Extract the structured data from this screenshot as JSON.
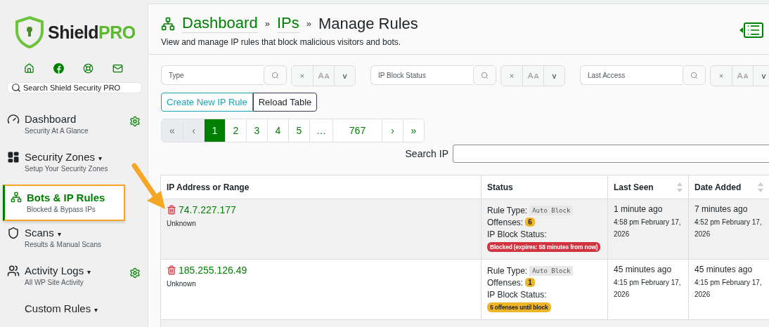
{
  "sidebar": {
    "logo": {
      "word": "Shield",
      "accent": "PRO"
    },
    "links": [
      {
        "kind": "home"
      },
      {
        "kind": "facebook"
      },
      {
        "kind": "support"
      },
      {
        "kind": "mail"
      }
    ],
    "search": {
      "placeholder": "Search Shield Security PRO"
    },
    "items": [
      {
        "kind": "dashboard",
        "title": "Dashboard",
        "subtitle": "Security At A Glance",
        "settings": true,
        "selected": false
      },
      {
        "kind": "zones",
        "title": "Security Zones",
        "caret": "▾",
        "subtitle": "Setup Your Security Zones",
        "settings": false,
        "selected": false
      },
      {
        "kind": "network",
        "title": "Bots & IP Rules",
        "subtitle": "Blocked & Bypass IPs",
        "settings": false,
        "selected": true
      },
      {
        "kind": "shield",
        "title": "Scans",
        "caret": "▾",
        "subtitle": "Results & Manual Scans",
        "settings": false,
        "selected": false
      },
      {
        "kind": "logs",
        "title": "Activity Logs",
        "caret": "▾",
        "subtitle": "All WP Site Activity",
        "settings": true,
        "selected": false
      },
      {
        "kind": "none",
        "title": "Custom Rules",
        "caret": "▾",
        "settings": false,
        "selected": false
      }
    ]
  },
  "header": {
    "breadcrumb": [
      {
        "label": "Dashboard",
        "kind": "link"
      },
      {
        "label": "»",
        "kind": "separator"
      },
      {
        "label": "IPs",
        "kind": "link"
      },
      {
        "label": "»",
        "kind": "separator"
      },
      {
        "label": "Manage Rules",
        "kind": "current"
      }
    ],
    "description": "View and manage IP rules that block malicious visitors and bots."
  },
  "filters": [
    {
      "placeholder": "Type",
      "clear": "×",
      "more": "v"
    },
    {
      "placeholder": "IP Block Status",
      "clear": "×",
      "more": "v"
    },
    {
      "placeholder": "Last Access",
      "clear": "×",
      "more": "v"
    }
  ],
  "actions": [
    {
      "label": "Create New IP Rule",
      "kind": "primary"
    },
    {
      "label": "Reload Table",
      "kind": "secondary"
    }
  ],
  "pagination": [
    {
      "label": "«",
      "selected": false,
      "disabled": true
    },
    {
      "label": "‹",
      "selected": false,
      "disabled": true
    },
    {
      "label": "1",
      "selected": true,
      "disabled": false
    },
    {
      "label": "2",
      "selected": false,
      "disabled": false
    },
    {
      "label": "3",
      "selected": false,
      "disabled": false
    },
    {
      "label": "4",
      "selected": false,
      "disabled": false
    },
    {
      "label": "5",
      "selected": false,
      "disabled": false
    },
    {
      "label": "…",
      "selected": false,
      "disabled": false
    },
    {
      "label": "767",
      "selected": false,
      "disabled": false
    },
    {
      "label": "›",
      "selected": false,
      "disabled": false
    },
    {
      "label": "»",
      "selected": false,
      "disabled": false
    }
  ],
  "search_ip": {
    "label": "Search IP"
  },
  "table": {
    "columns": [
      {
        "label": "IP Address or Range",
        "sortable": false
      },
      {
        "label": "Status",
        "sortable": false
      },
      {
        "label": "Last Seen",
        "sortable": true
      },
      {
        "label": "Date Added",
        "sortable": true
      }
    ],
    "rows": [
      {
        "ip": "74.7.227.177",
        "location": "Unknown",
        "rule_type_label": "Rule Type:",
        "rule_type": "Auto Block",
        "offenses_label": "Offenses:",
        "offenses": "6",
        "block_status_label": "IP Block Status:",
        "badge": {
          "text": "Blocked (expires: 58 minutes from now)",
          "kind": "blocked"
        },
        "last_seen": "1 minute ago",
        "last_seen_date": "4:58 pm February 17, 2026",
        "date_added": "7 minutes ago",
        "date_added_date": "4:52 pm February 17, 2026"
      },
      {
        "ip": "185.255.126.49",
        "location": "Unknown",
        "rule_type_label": "Rule Type:",
        "rule_type": "Auto Block",
        "offenses_label": "Offenses:",
        "offenses": "1",
        "block_status_label": "IP Block Status:",
        "badge": {
          "text": "5 offenses until block",
          "kind": "warning"
        },
        "last_seen": "45 minutes ago",
        "last_seen_date": "4:15 pm February 17, 2026",
        "date_added": "45 minutes ago",
        "date_added_date": "4:15 pm February 17, 2026"
      }
    ]
  }
}
